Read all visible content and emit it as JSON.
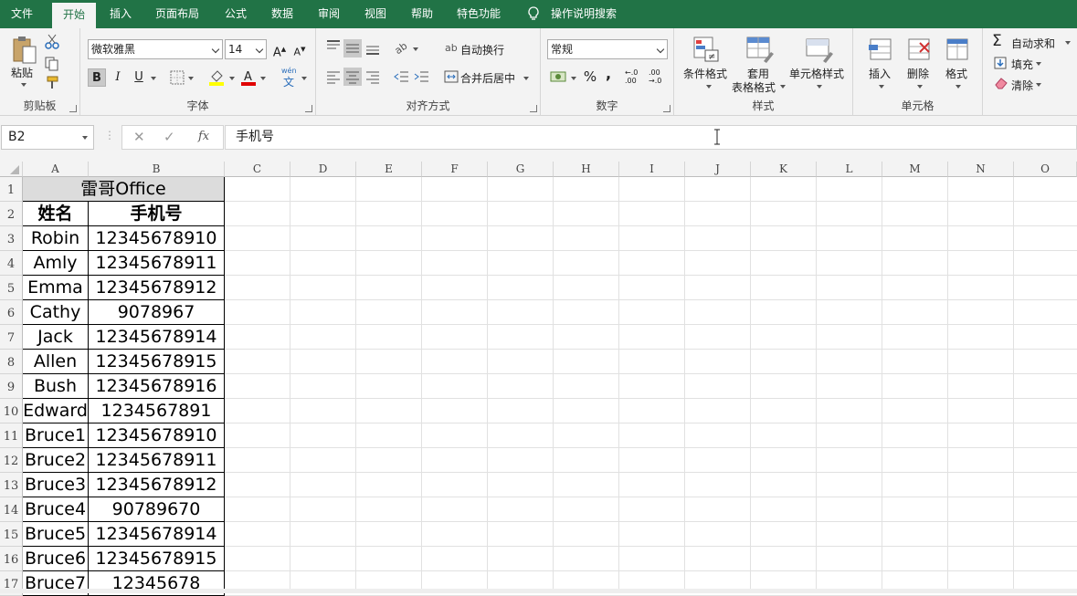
{
  "tabs": [
    "文件",
    "开始",
    "插入",
    "页面布局",
    "公式",
    "数据",
    "审阅",
    "视图",
    "帮助",
    "特色功能",
    "操作说明搜索"
  ],
  "clipboard": {
    "paste": "粘贴",
    "group": "剪贴板"
  },
  "font": {
    "name": "微软雅黑",
    "size": "14",
    "bold": "B",
    "italic": "I",
    "underline": "U",
    "phonetic": "wén",
    "group": "字体"
  },
  "align": {
    "wrap": "自动换行",
    "merge": "合并后居中",
    "group": "对齐方式"
  },
  "number": {
    "format": "常规",
    "percent": "%",
    "comma": ",",
    "group": "数字"
  },
  "styles": {
    "cond": "条件格式",
    "table1": "套用",
    "table2": "表格格式",
    "cell": "单元格样式",
    "group": "样式"
  },
  "cells": {
    "insert": "插入",
    "delete": "删除",
    "format": "格式",
    "group": "单元格"
  },
  "edit": {
    "autosum": "自动求和",
    "fill": "填充",
    "clear": "清除"
  },
  "formula_bar": {
    "name_box": "B2",
    "content": "手机号",
    "fx": "fx"
  },
  "columns": [
    "A",
    "B",
    "C",
    "D",
    "E",
    "F",
    "G",
    "H",
    "I",
    "J",
    "K",
    "L",
    "M",
    "N",
    "O"
  ],
  "rows": [
    "1",
    "2",
    "3",
    "4",
    "5",
    "6",
    "7",
    "8",
    "9",
    "10",
    "11",
    "12",
    "13",
    "14",
    "15",
    "16",
    "17"
  ],
  "title": "雷哥Office",
  "headers": [
    "姓名",
    "手机号"
  ],
  "data": [
    [
      "Robin",
      "12345678910"
    ],
    [
      "Amly",
      "12345678911"
    ],
    [
      "Emma",
      "12345678912"
    ],
    [
      "Cathy",
      "9078967"
    ],
    [
      "Jack",
      "12345678914"
    ],
    [
      "Allen",
      "12345678915"
    ],
    [
      "Bush",
      "12345678916"
    ],
    [
      "Edward",
      "1234567891"
    ],
    [
      "Bruce1",
      "12345678910"
    ],
    [
      "Bruce2",
      "12345678911"
    ],
    [
      "Bruce3",
      "12345678912"
    ],
    [
      "Bruce4",
      "90789670"
    ],
    [
      "Bruce5",
      "12345678914"
    ],
    [
      "Bruce6",
      "12345678915"
    ],
    [
      "Bruce7",
      "12345678"
    ]
  ],
  "colors": {
    "accent": "#217346"
  }
}
